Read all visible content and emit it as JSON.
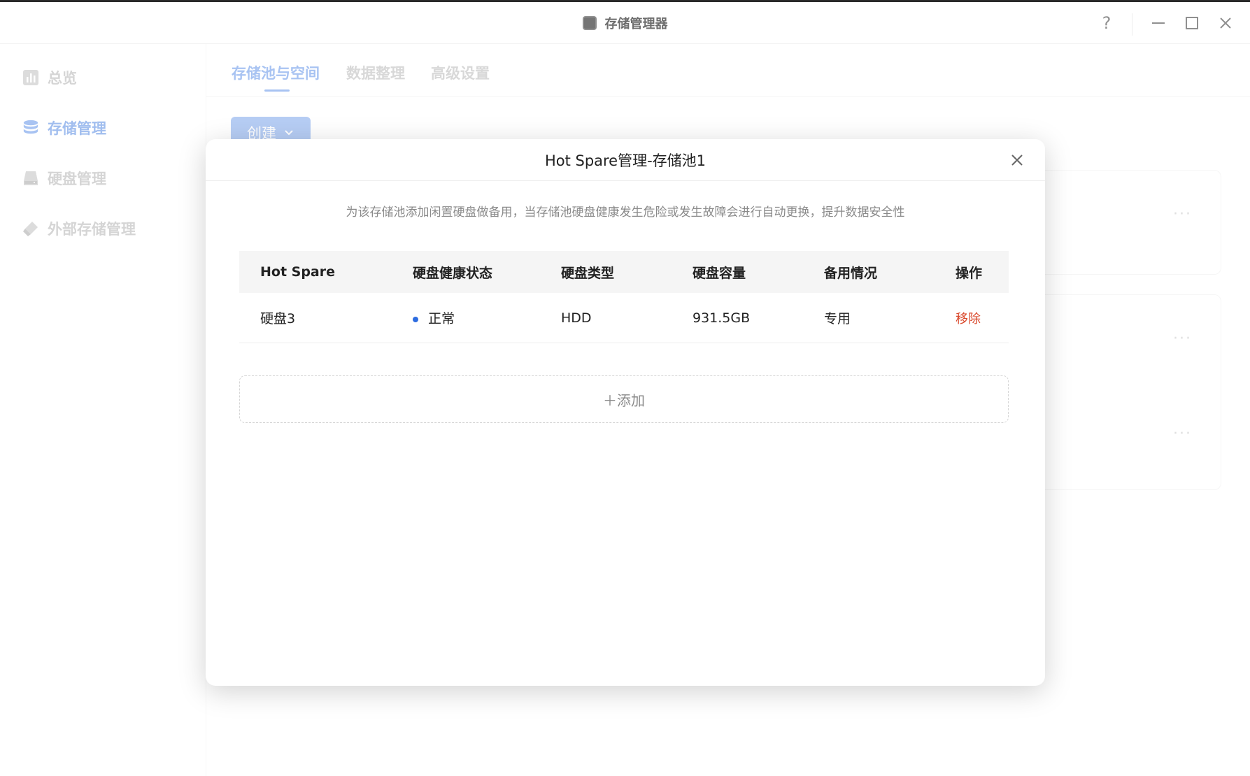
{
  "window": {
    "title": "存储管理器"
  },
  "titlebar_controls": {
    "help": "?"
  },
  "sidebar": {
    "items": [
      {
        "label": "总览",
        "icon": "chart-icon"
      },
      {
        "label": "存储管理",
        "icon": "database-icon",
        "active": true
      },
      {
        "label": "硬盘管理",
        "icon": "harddisk-icon"
      },
      {
        "label": "外部存储管理",
        "icon": "usb-drive-icon"
      }
    ]
  },
  "tabs": [
    {
      "label": "存储池与空间",
      "active": true
    },
    {
      "label": "数据整理"
    },
    {
      "label": "高级设置"
    }
  ],
  "create_button": {
    "label": "创建"
  },
  "modal": {
    "title": "Hot Spare管理-存储池1",
    "description": "为该存储池添加闲置硬盘做备用，当存储池硬盘健康发生危险或发生故障会进行自动更换，提升数据安全性",
    "table": {
      "headers": [
        "Hot Spare",
        "硬盘健康状态",
        "硬盘类型",
        "硬盘容量",
        "备用情况",
        "操作"
      ],
      "rows": [
        {
          "disk": "硬盘3",
          "health": "正常",
          "type": "HDD",
          "capacity": "931.5GB",
          "usage": "专用",
          "action": "移除"
        }
      ]
    },
    "add_label": "＋添加"
  },
  "colors": {
    "accent": "#6f9be6",
    "status_normal": "#2d6ce0",
    "danger": "#d9482b"
  }
}
